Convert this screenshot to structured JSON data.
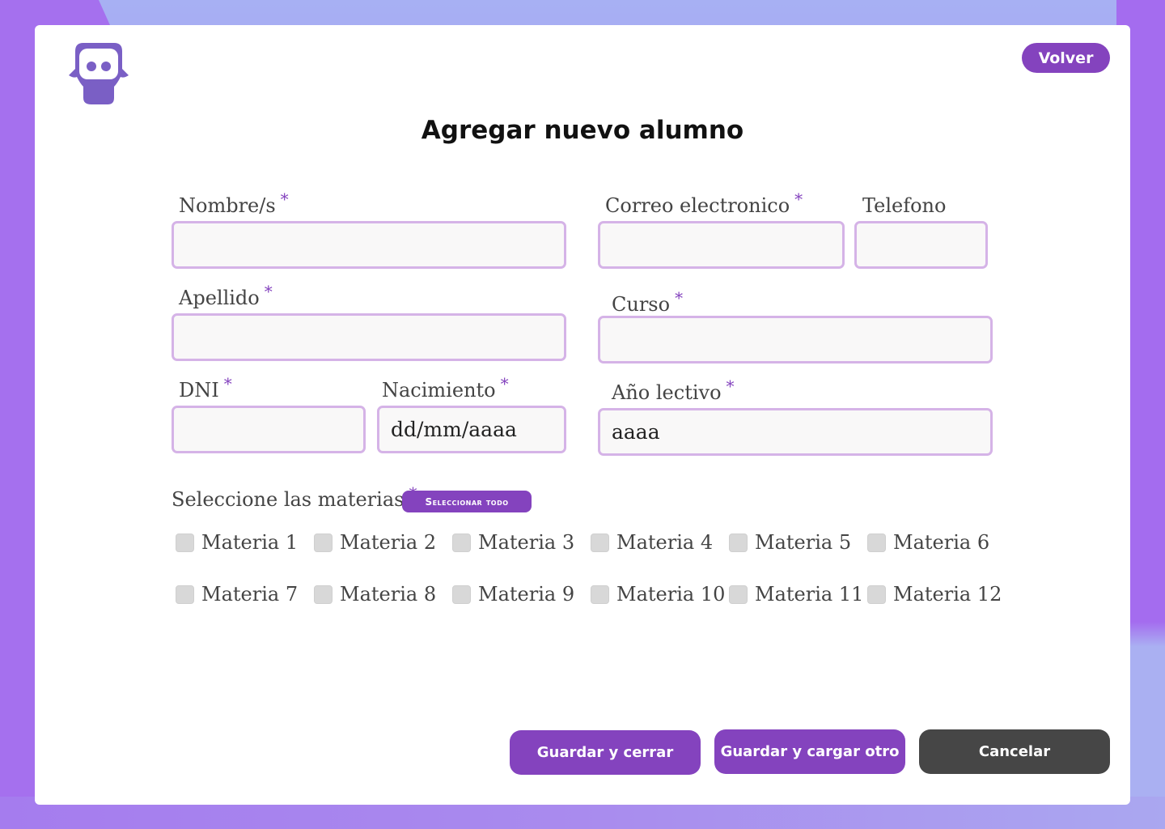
{
  "header": {
    "back_label": "Volver",
    "title": "Agregar nuevo alumno"
  },
  "form": {
    "required_mark": "*",
    "nombre": {
      "label": "Nombre/s",
      "value": ""
    },
    "apellido": {
      "label": "Apellido",
      "value": ""
    },
    "dni": {
      "label": "DNI",
      "value": ""
    },
    "nacimiento": {
      "label": "Nacimiento",
      "placeholder": "dd/mm/aaaa"
    },
    "correo": {
      "label": "Correo electronico",
      "value": ""
    },
    "telefono": {
      "label": "Telefono",
      "value": ""
    },
    "curso": {
      "label": "Curso",
      "value": ""
    },
    "anio_lectivo": {
      "label": "Año lectivo",
      "placeholder": "aaaa"
    }
  },
  "subjects": {
    "label": "Seleccione las materias",
    "select_all_label": "Seleccionar todo",
    "items": [
      "Materia 1",
      "Materia 2",
      "Materia 3",
      "Materia 4",
      "Materia 5",
      "Materia 6",
      "Materia 7",
      "Materia 8",
      "Materia 9",
      "Materia 10",
      "Materia 11",
      "Materia 12"
    ]
  },
  "actions": {
    "save_close_label": "Guardar y cerrar",
    "save_another_label": "Guardar y cargar otro",
    "cancel_label": "Cancelar"
  },
  "colors": {
    "accent": "#8443be",
    "input_border": "#d5b3e7",
    "cancel": "#464646"
  },
  "icons": {
    "logo": "owl-logo-icon"
  }
}
